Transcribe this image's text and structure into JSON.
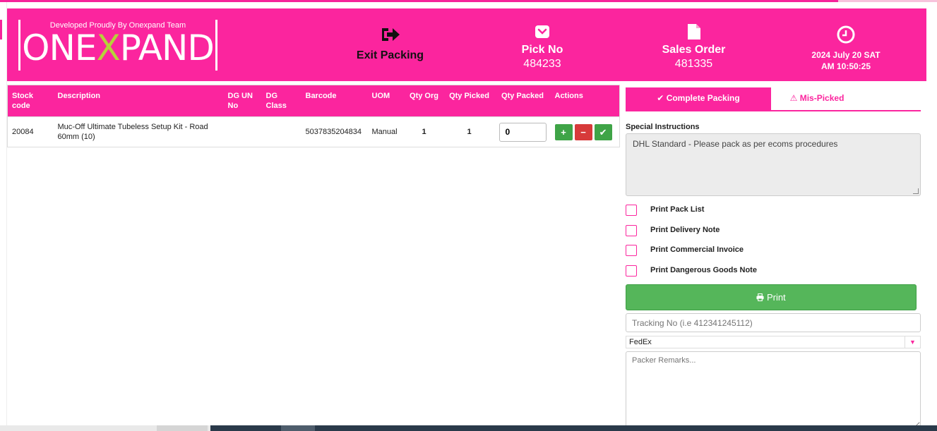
{
  "brand": {
    "tagline": "Developed Proudly By Onexpand Team",
    "logo_part1": "ONE",
    "logo_x": "X",
    "logo_part2": "PAND",
    "accent": "#fb259e",
    "logo_x_color": "#b6d23a"
  },
  "header": {
    "exit_label": "Exit Packing",
    "exit_icon": "sign-out-icon",
    "pick_label": "Pick No",
    "pick_value": "484233",
    "pick_icon": "pocket-icon",
    "sales_label": "Sales Order",
    "sales_value": "481335",
    "sales_icon": "file-icon",
    "date_line1": "2024 July 20 SAT",
    "date_line2": "AM 10:50:25",
    "clock_icon": "clock-icon"
  },
  "table": {
    "headers": [
      "Stock code",
      "Description",
      "DG UN No",
      "DG Class",
      "Barcode",
      "UOM",
      "Qty Org",
      "Qty Picked",
      "Qty Packed",
      "Actions"
    ],
    "rows": [
      {
        "stock_code": "20084",
        "description": "Muc-Off Ultimate Tubeless Setup Kit - Road 60mm (10)",
        "dg_un_no": "",
        "dg_class": "",
        "barcode": "5037835204834",
        "uom": "Manual",
        "qty_org": "1",
        "qty_picked": "1",
        "qty_packed": "0"
      }
    ],
    "action_icons": [
      "plus-icon",
      "minus-icon",
      "check-icon"
    ]
  },
  "panel": {
    "tab_complete": "Complete Packing",
    "tab_mispicked": "Mis-Picked",
    "special_label": "Special Instructions",
    "special_text": "DHL Standard - Please pack as per ecoms procedures",
    "checks": [
      "Print Pack List",
      "Print Delivery Note",
      "Print Commercial Invoice",
      "Print Dangerous Goods Note"
    ],
    "print_label": "Print",
    "tracking_placeholder": "Tracking No (i.e 412341245112)",
    "courier_value": "FedEx",
    "remarks_placeholder": "Packer Remarks..."
  },
  "colors": {
    "green": "#55b65a",
    "red": "#d73a3a"
  }
}
